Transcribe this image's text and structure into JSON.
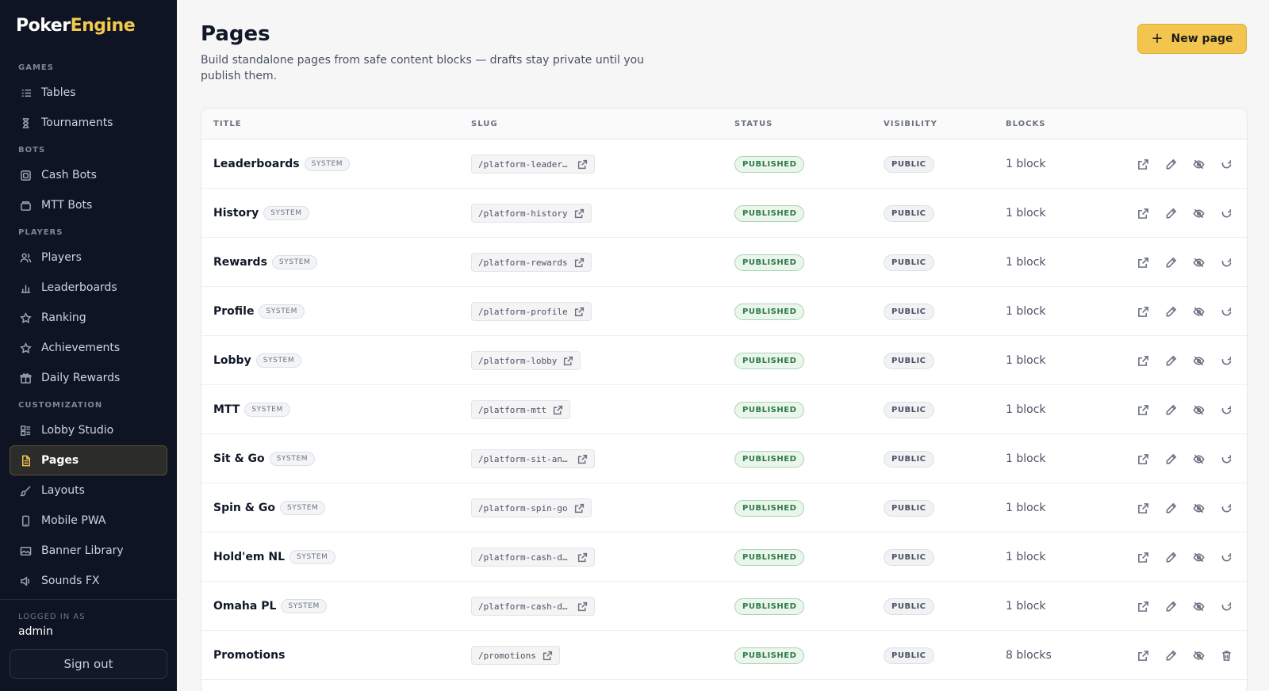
{
  "brand": {
    "part1": "Poker",
    "part2": "Engine"
  },
  "sidebar": {
    "sections": [
      {
        "label": "GAMES",
        "items": [
          {
            "label": "Tables",
            "icon": "list-icon"
          },
          {
            "label": "Tournaments",
            "icon": "hourglass-icon"
          }
        ]
      },
      {
        "label": "BOTS",
        "items": [
          {
            "label": "Cash Bots",
            "icon": "chip-icon"
          },
          {
            "label": "MTT Bots",
            "icon": "box-icon"
          }
        ]
      },
      {
        "label": "PLAYERS",
        "items": [
          {
            "label": "Players",
            "icon": "users-icon"
          },
          {
            "label": "Leaderboards",
            "icon": "bar-chart-icon"
          },
          {
            "label": "Ranking",
            "icon": "star-icon"
          },
          {
            "label": "Achievements",
            "icon": "star-icon"
          },
          {
            "label": "Daily Rewards",
            "icon": "gift-icon"
          }
        ]
      },
      {
        "label": "CUSTOMIZATION",
        "items": [
          {
            "label": "Lobby Studio",
            "icon": "layout-icon"
          },
          {
            "label": "Pages",
            "icon": "file-icon",
            "active": true
          },
          {
            "label": "Layouts",
            "icon": "brush-icon"
          },
          {
            "label": "Mobile PWA",
            "icon": "phone-icon"
          },
          {
            "label": "Banner Library",
            "icon": "image-icon"
          },
          {
            "label": "Sounds FX",
            "icon": "sound-icon"
          }
        ]
      }
    ],
    "logged_in_label": "LOGGED IN AS",
    "username": "admin",
    "sign_out": "Sign out"
  },
  "header": {
    "title": "Pages",
    "subtitle": "Build standalone pages from safe content blocks — drafts stay private until you publish them.",
    "new_button": "New page"
  },
  "table": {
    "columns": [
      "TITLE",
      "SLUG",
      "STATUS",
      "VISIBILITY",
      "BLOCKS"
    ],
    "rows": [
      {
        "title": "Leaderboards",
        "system": "SYSTEM",
        "slug": "/platform-leaderbo…",
        "status": "PUBLISHED",
        "visibility": "PUBLIC",
        "blocks": "1 block",
        "last_action": "reset-icon"
      },
      {
        "title": "History",
        "system": "SYSTEM",
        "slug": "/platform-history",
        "status": "PUBLISHED",
        "visibility": "PUBLIC",
        "blocks": "1 block",
        "last_action": "reset-icon"
      },
      {
        "title": "Rewards",
        "system": "SYSTEM",
        "slug": "/platform-rewards",
        "status": "PUBLISHED",
        "visibility": "PUBLIC",
        "blocks": "1 block",
        "last_action": "reset-icon"
      },
      {
        "title": "Profile",
        "system": "SYSTEM",
        "slug": "/platform-profile",
        "status": "PUBLISHED",
        "visibility": "PUBLIC",
        "blocks": "1 block",
        "last_action": "reset-icon"
      },
      {
        "title": "Lobby",
        "system": "SYSTEM",
        "slug": "/platform-lobby",
        "status": "PUBLISHED",
        "visibility": "PUBLIC",
        "blocks": "1 block",
        "last_action": "reset-icon"
      },
      {
        "title": "MTT",
        "system": "SYSTEM",
        "slug": "/platform-mtt",
        "status": "PUBLISHED",
        "visibility": "PUBLIC",
        "blocks": "1 block",
        "last_action": "reset-icon"
      },
      {
        "title": "Sit & Go",
        "system": "SYSTEM",
        "slug": "/platform-sit-and-…",
        "status": "PUBLISHED",
        "visibility": "PUBLIC",
        "blocks": "1 block",
        "last_action": "reset-icon"
      },
      {
        "title": "Spin & Go",
        "system": "SYSTEM",
        "slug": "/platform-spin-go",
        "status": "PUBLISHED",
        "visibility": "PUBLIC",
        "blocks": "1 block",
        "last_action": "reset-icon"
      },
      {
        "title": "Hold'em NL",
        "system": "SYSTEM",
        "slug": "/platform-cash-dem…",
        "status": "PUBLISHED",
        "visibility": "PUBLIC",
        "blocks": "1 block",
        "last_action": "reset-icon"
      },
      {
        "title": "Omaha PL",
        "system": "SYSTEM",
        "slug": "/platform-cash-dem…",
        "status": "PUBLISHED",
        "visibility": "PUBLIC",
        "blocks": "1 block",
        "last_action": "reset-icon"
      },
      {
        "title": "Promotions",
        "system": "",
        "slug": "/promotions",
        "status": "PUBLISHED",
        "visibility": "PUBLIC",
        "blocks": "8 blocks",
        "last_action": "trash-icon"
      }
    ]
  },
  "colors": {
    "accent": "#f1c54e",
    "sidebar_bg": "#0f1424",
    "published": "#2f7a48"
  }
}
